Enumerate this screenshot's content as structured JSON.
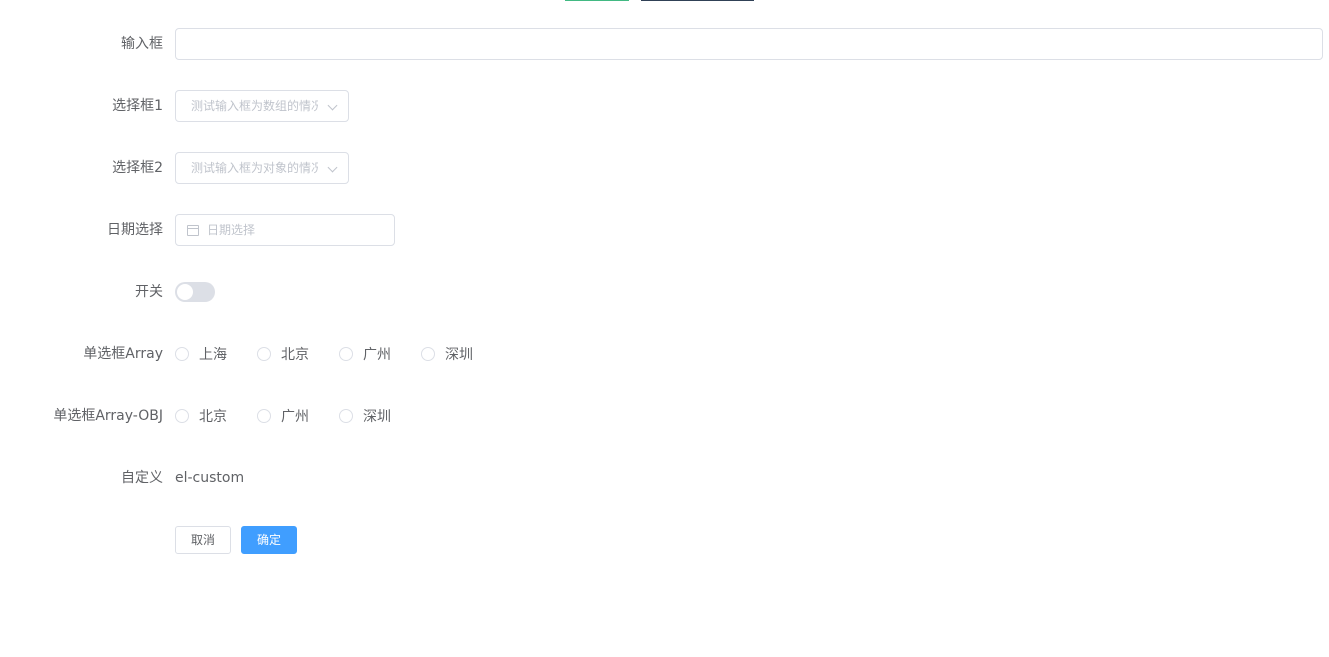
{
  "form": {
    "input": {
      "label": "输入框",
      "value": "",
      "placeholder": ""
    },
    "select1": {
      "label": "选择框1",
      "placeholder": "测试输入框为数组的情况"
    },
    "select2": {
      "label": "选择框2",
      "placeholder": "测试输入框为对象的情况"
    },
    "date": {
      "label": "日期选择",
      "placeholder": "日期选择"
    },
    "switch": {
      "label": "开关"
    },
    "radio_array": {
      "label": "单选框Array",
      "options": [
        "上海",
        "北京",
        "广州",
        "深圳"
      ]
    },
    "radio_array_obj": {
      "label": "单选框Array-OBJ",
      "options": [
        "北京",
        "广州",
        "深圳"
      ]
    },
    "custom": {
      "label": "自定义",
      "value": "el-custom"
    },
    "buttons": {
      "cancel": "取消",
      "confirm": "确定"
    }
  },
  "colors": {
    "primary": "#409eff",
    "tab_green": "#42b983",
    "tab_dark": "#304156"
  }
}
